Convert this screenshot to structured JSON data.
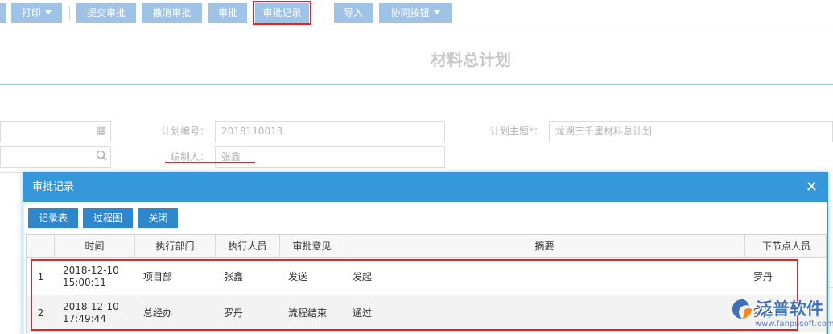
{
  "toolbar": {
    "print": "打印",
    "submit_approval": "提交审批",
    "cancel_approval": "撤消审批",
    "approve": "审批",
    "approval_records": "审批记录",
    "import": "导入",
    "collab": "协同按钮"
  },
  "form": {
    "title": "材料总计划",
    "plan_no_label": "计划编号：",
    "plan_no_value": "2018110013",
    "plan_subject_label": "计划主题*：",
    "plan_subject_value": "龙湖三千里材料总计划",
    "author_label": "编制人：",
    "author_value": "张鑫"
  },
  "modal": {
    "title": "审批记录",
    "buttons": {
      "records_table": "记录表",
      "process_chart": "过程图",
      "close": "关闭"
    },
    "columns": [
      "时间",
      "执行部门",
      "执行人员",
      "审批意见",
      "摘要",
      "下节点人员"
    ],
    "rows": [
      {
        "no": "1",
        "date": "2018-12-10",
        "time": "15:00:11",
        "dept": "项目部",
        "person": "张鑫",
        "opinion": "发送",
        "summary": "发起",
        "next": "罗丹"
      },
      {
        "no": "2",
        "date": "2018-12-10",
        "time": "17:49:44",
        "dept": "总经办",
        "person": "罗丹",
        "opinion": "流程结束",
        "summary": "通过",
        "next": "罗丹"
      }
    ]
  },
  "watermark": {
    "brand": "泛普软件",
    "url": "www.fanpusoft.com"
  },
  "colors": {
    "header_blue": "#3598db",
    "button_blue": "#2d87cd",
    "toolbar_blue": "#9fc3e7",
    "highlight_red": "#e0262b"
  }
}
